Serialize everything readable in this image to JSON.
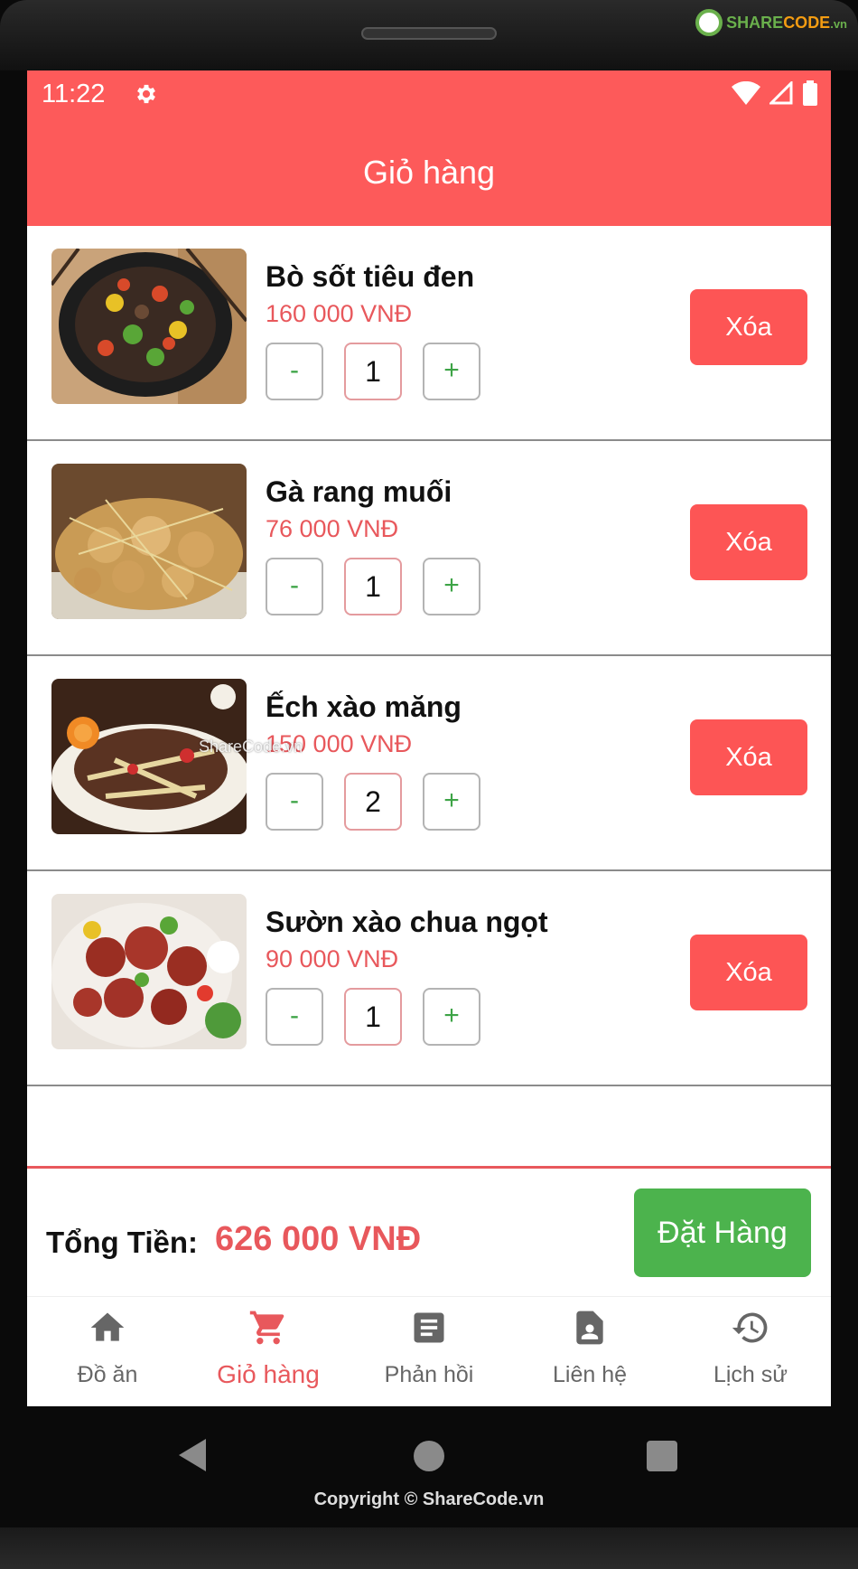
{
  "watermark": {
    "brand_left": "SHARE",
    "brand_right": "CODE",
    "brand_suffix": ".vn"
  },
  "status": {
    "time": "11:22"
  },
  "appbar": {
    "title": "Giỏ hàng"
  },
  "cart": {
    "items": [
      {
        "name": "Bò sốt tiêu đen",
        "price": "160 000 VNĐ",
        "qty": "1",
        "minus": "-",
        "plus": "+",
        "delete": "Xóa",
        "image": "black-pepper-beef"
      },
      {
        "name": "Gà rang muối",
        "price": "76 000 VNĐ",
        "qty": "1",
        "minus": "-",
        "plus": "+",
        "delete": "Xóa",
        "image": "salt-roasted-chicken"
      },
      {
        "name": "Ếch xào măng",
        "price": "150 000 VNĐ",
        "qty": "2",
        "minus": "-",
        "plus": "+",
        "delete": "Xóa",
        "image": "frog-bamboo-stirfry"
      },
      {
        "name": "Sườn xào chua ngọt",
        "price": "90 000 VNĐ",
        "qty": "1",
        "minus": "-",
        "plus": "+",
        "delete": "Xóa",
        "image": "sweet-sour-ribs"
      }
    ],
    "overlay_watermark": "ShareCode.vn"
  },
  "footer": {
    "total_label": "Tổng Tiền:",
    "total_value": "626 000 VNĐ",
    "order_button": "Đặt Hàng"
  },
  "nav": {
    "items": [
      {
        "label": "Đồ ăn",
        "icon": "home-icon",
        "active": false
      },
      {
        "label": "Giỏ hàng",
        "icon": "cart-icon",
        "active": true
      },
      {
        "label": "Phản hồi",
        "icon": "document-icon",
        "active": false
      },
      {
        "label": "Liên hệ",
        "icon": "contact-icon",
        "active": false
      },
      {
        "label": "Lịch sử",
        "icon": "history-icon",
        "active": false
      }
    ]
  },
  "copyright": "Copyright © ShareCode.vn",
  "colors": {
    "primary": "#fd5a5a",
    "price": "#e8585c",
    "order": "#4cb34d",
    "qty_sign": "#3ea447"
  }
}
